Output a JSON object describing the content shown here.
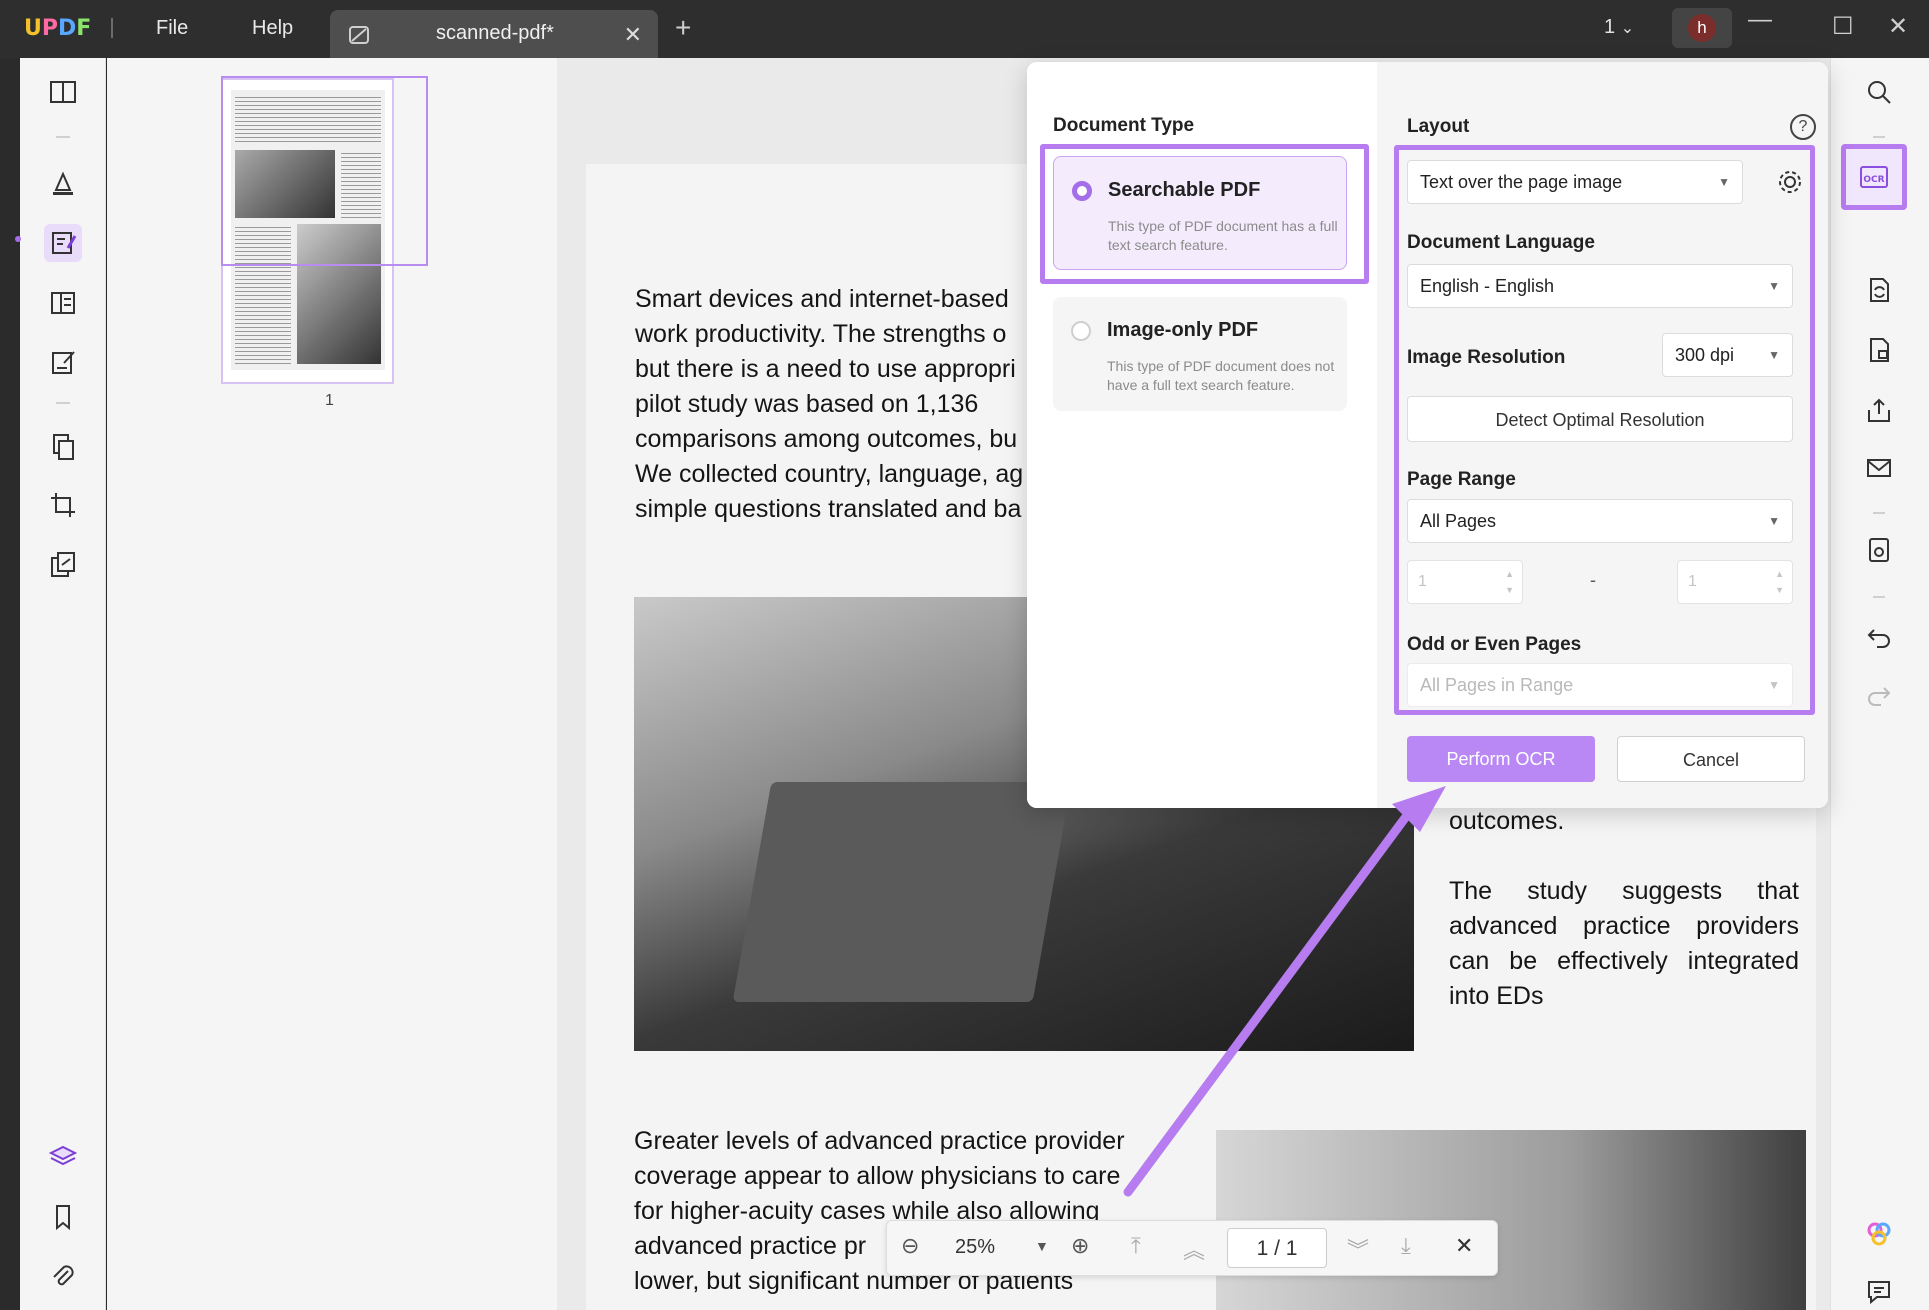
{
  "app": {
    "logo": "UPDF",
    "menu": [
      "File",
      "Help"
    ],
    "tab_title": "scanned-pdf*",
    "page_selector": "1",
    "avatar_initial": "h"
  },
  "thumbnails": [
    {
      "label": "1"
    }
  ],
  "document": {
    "para1": "Smart devices and internet-based\nwork productivity. The strengths o\nbut there is a need to use appropri\npilot study was based on 1,136\ncomparisons among outcomes, bu\nWe collected country, language, ag\nsimple questions translated and ba",
    "para2": "outcomes.\n\nThe study suggests that advanced practice providers can be effectively integrated into EDs",
    "para3": "Greater levels of advanced practice provider\ncoverage appear to allow physicians to care\nfor higher-acuity cases while also allowing\nadvanced practice pr\nlower, but significant number of patients"
  },
  "zoombar": {
    "zoom": "25%",
    "page_indicator": "1 / 1"
  },
  "ocr_dialog": {
    "document_type": {
      "title": "Document Type",
      "options": [
        {
          "label": "Searchable PDF",
          "desc": "This type of PDF document has a full text search feature.",
          "selected": true
        },
        {
          "label": "Image-only PDF",
          "desc": "This type of PDF document does not have a full text search feature.",
          "selected": false
        }
      ]
    },
    "layout": {
      "title": "Layout",
      "value": "Text over the page image"
    },
    "language": {
      "title": "Document Language",
      "value": "English - English"
    },
    "resolution": {
      "title": "Image Resolution",
      "value": "300 dpi",
      "detect_label": "Detect Optimal Resolution"
    },
    "page_range": {
      "title": "Page Range",
      "value": "All Pages",
      "from": "1",
      "to": "1",
      "separator": "-"
    },
    "odd_even": {
      "title": "Odd or Even Pages",
      "value": "All Pages in Range"
    },
    "perform_label": "Perform OCR",
    "cancel_label": "Cancel"
  },
  "colors": {
    "accent": "#b77cf0",
    "button": "#b988f5"
  }
}
